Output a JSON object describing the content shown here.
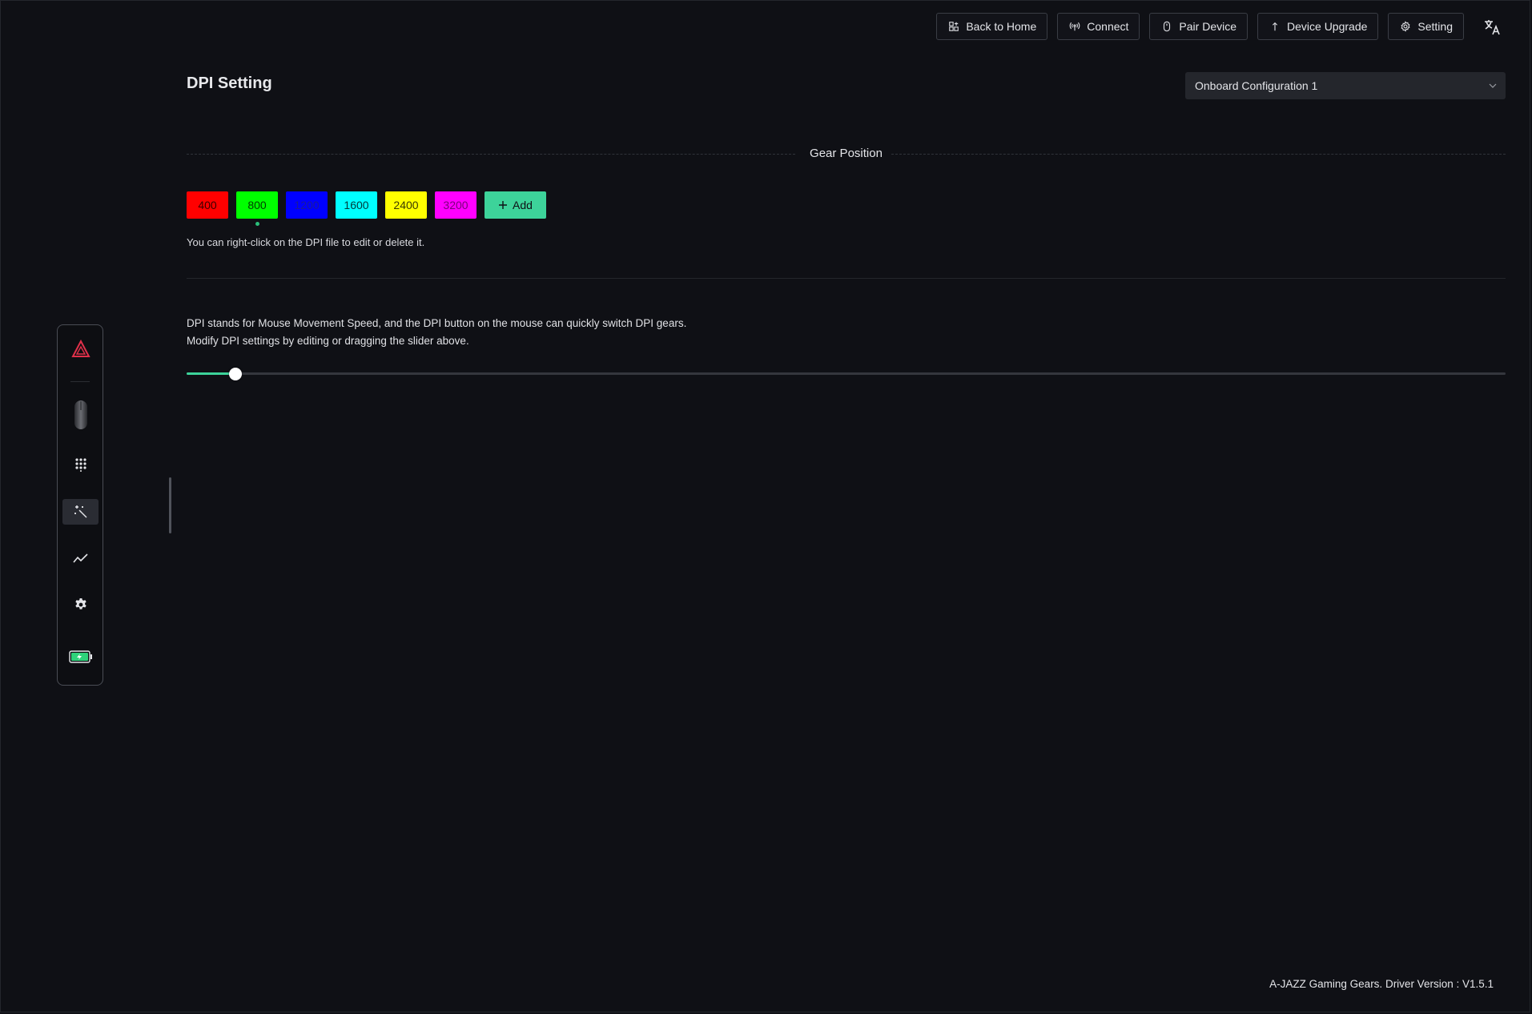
{
  "topbar": {
    "buttons": [
      {
        "label": "Back to Home",
        "icon": "home-icon"
      },
      {
        "label": "Connect",
        "icon": "signal-icon"
      },
      {
        "label": "Pair Device",
        "icon": "mouse-icon"
      },
      {
        "label": "Device Upgrade",
        "icon": "upgrade-icon"
      },
      {
        "label": "Setting",
        "icon": "gear-icon"
      }
    ],
    "language_icon": "translate-icon"
  },
  "page": {
    "title": "DPI Setting",
    "config_select": {
      "value": "Onboard Configuration 1"
    },
    "gear_position_label": "Gear Position",
    "dpi_levels": [
      {
        "value": "400",
        "bg": "#ff0000",
        "fg": "#3a0000"
      },
      {
        "value": "800",
        "bg": "#00ff00",
        "fg": "#003a00",
        "active": true
      },
      {
        "value": "1200",
        "bg": "#0000ff",
        "fg": "#1a1a9a"
      },
      {
        "value": "1600",
        "bg": "#00ffff",
        "fg": "#003a3a"
      },
      {
        "value": "2400",
        "bg": "#ffff00",
        "fg": "#3a3a00"
      },
      {
        "value": "3200",
        "bg": "#ff00ff",
        "fg": "#7a007a"
      }
    ],
    "add_label": "Add",
    "hint": "You can right-click on the DPI file to edit or delete it.",
    "description_line1": "DPI stands for Mouse Movement Speed, and the DPI button on the mouse can quickly switch DPI gears.",
    "description_line2": "Modify DPI settings by editing or dragging the slider above.",
    "slider": {
      "fraction": 0.037
    },
    "accent": "#3dd39a"
  },
  "sidebar": {
    "items": [
      {
        "name": "logo",
        "icon": "brand-logo-icon"
      },
      {
        "name": "device",
        "icon": "mouse-image"
      },
      {
        "name": "keys",
        "icon": "keypad-icon"
      },
      {
        "name": "dpi",
        "icon": "magic-wand-icon",
        "active": true
      },
      {
        "name": "performance",
        "icon": "trend-line-icon"
      },
      {
        "name": "settings",
        "icon": "gear-icon"
      },
      {
        "name": "battery",
        "icon": "battery-icon"
      }
    ]
  },
  "footer": {
    "text": "A-JAZZ Gaming Gears. Driver Version : V1.5.1"
  }
}
